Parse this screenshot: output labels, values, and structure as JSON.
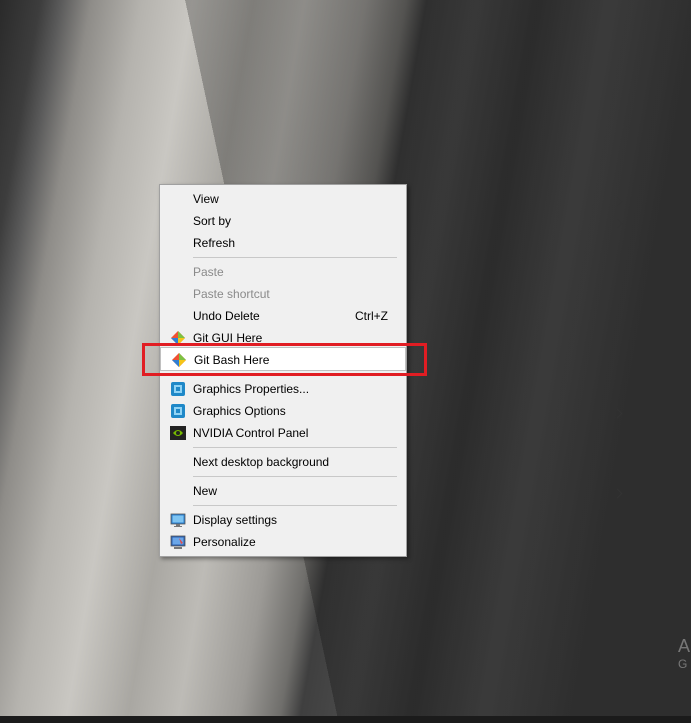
{
  "menu": {
    "view": "View",
    "sort_by": "Sort by",
    "refresh": "Refresh",
    "paste": "Paste",
    "paste_shortcut": "Paste shortcut",
    "undo_delete": "Undo Delete",
    "undo_delete_shortcut": "Ctrl+Z",
    "git_gui": "Git GUI Here",
    "git_bash": "Git Bash Here",
    "graphics_properties": "Graphics Properties...",
    "graphics_options": "Graphics Options",
    "nvidia": "NVIDIA Control Panel",
    "next_background": "Next desktop background",
    "new": "New",
    "display_settings": "Display settings",
    "personalize": "Personalize"
  },
  "watermark": {
    "line1": "A",
    "line2": "G"
  },
  "colors": {
    "highlight_box": "#e11d23",
    "menu_bg": "#f0f0f0",
    "disabled_text": "#8a8a8a"
  }
}
